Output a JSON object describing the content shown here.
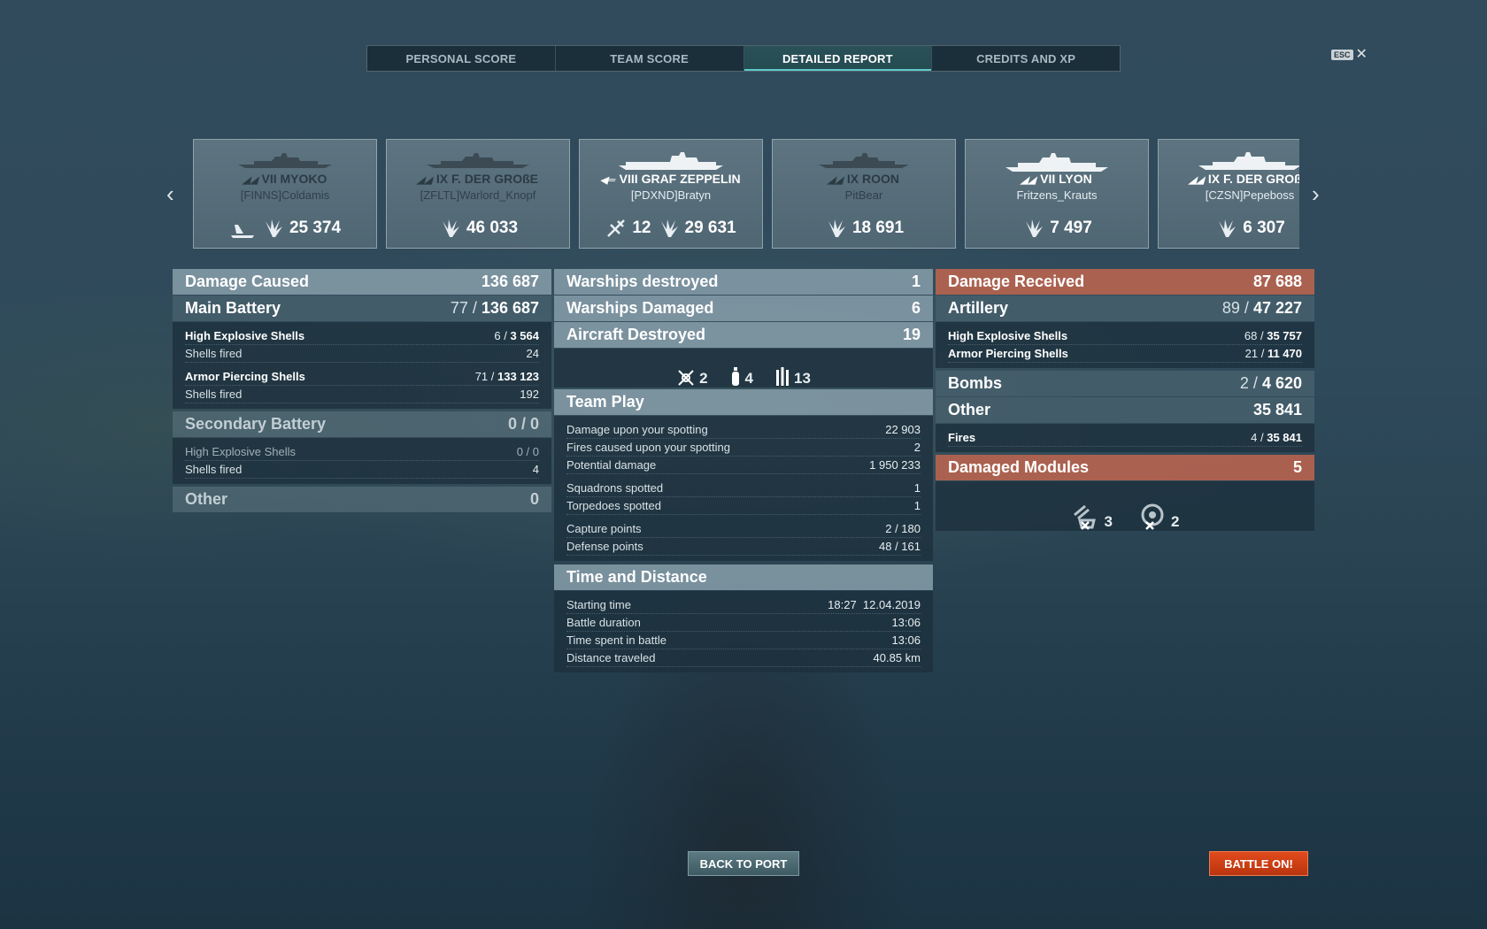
{
  "tabs": [
    {
      "label": "PERSONAL SCORE"
    },
    {
      "label": "TEAM SCORE"
    },
    {
      "label": "DETAILED REPORT"
    },
    {
      "label": "CREDITS AND XP"
    }
  ],
  "esc": {
    "badge": "ESC",
    "close": "✕"
  },
  "nav": {
    "prev": "‹",
    "next": "›"
  },
  "cards": [
    {
      "tier_name": "VII MYOKO",
      "player": "[FINNS]Coldamis",
      "stats": [
        {
          "icon": "torpedo-hit-icon",
          "value": ""
        },
        {
          "icon": "damage-icon",
          "value": "25 374"
        }
      ]
    },
    {
      "tier_name": "IX F. DER GROßE",
      "player": "[ZFLTL]Warlord_Knopf",
      "stats": [
        {
          "icon": "damage-icon",
          "value": "46 033"
        }
      ]
    },
    {
      "tier_name": "VIII GRAF ZEPPELIN",
      "player": "[PDXND]Bratyn",
      "stats": [
        {
          "icon": "aircraft-destroyed-icon",
          "value": "12"
        },
        {
          "icon": "damage-icon",
          "value": "29 631"
        }
      ]
    },
    {
      "tier_name": "IX ROON",
      "player": "PitBear",
      "stats": [
        {
          "icon": "damage-icon",
          "value": "18 691"
        }
      ]
    },
    {
      "tier_name": "VII LYON",
      "player": "Fritzens_Krauts",
      "stats": [
        {
          "icon": "damage-icon",
          "value": "7 497"
        }
      ]
    },
    {
      "tier_name": "IX F. DER GROßE",
      "player": "[CZSN]Pepeboss",
      "stats": [
        {
          "icon": "damage-icon",
          "value": "6 307"
        }
      ]
    }
  ],
  "left": {
    "damage_caused": {
      "label": "Damage Caused",
      "value": "136 687"
    },
    "main_battery": {
      "label": "Main Battery",
      "hits": "77 /",
      "damage": "136 687"
    },
    "he": {
      "label": "High Explosive Shells",
      "hits": "6 /",
      "damage": "3 564"
    },
    "he_fired": {
      "label": "Shells fired",
      "value": "24"
    },
    "ap": {
      "label": "Armor Piercing Shells",
      "hits": "71 /",
      "damage": "133 123"
    },
    "ap_fired": {
      "label": "Shells fired",
      "value": "192"
    },
    "secondary": {
      "label": "Secondary Battery",
      "value": "0 / 0"
    },
    "sec_he": {
      "label": "High Explosive Shells",
      "value": "0 / 0"
    },
    "sec_fired": {
      "label": "Shells fired",
      "value": "4"
    },
    "other": {
      "label": "Other",
      "value": "0"
    }
  },
  "middle": {
    "warships_destroyed": {
      "label": "Warships destroyed",
      "value": "1"
    },
    "warships_damaged": {
      "label": "Warships Damaged",
      "value": "6"
    },
    "aircraft_destroyed": {
      "label": "Aircraft Destroyed",
      "value": "19"
    },
    "aircraft_breakdown": [
      {
        "icon": "fighter-icon",
        "value": "2"
      },
      {
        "icon": "bomber-icon",
        "value": "4"
      },
      {
        "icon": "torpedo-bomber-icon",
        "value": "13"
      }
    ],
    "team_play": {
      "label": "Team Play"
    },
    "rows_a": [
      {
        "label": "Damage upon your spotting",
        "value": "22 903"
      },
      {
        "label": "Fires caused upon your spotting",
        "value": "2"
      },
      {
        "label": "Potential damage",
        "value": "1 950 233"
      }
    ],
    "rows_b": [
      {
        "label": "Squadrons spotted",
        "value": "1"
      },
      {
        "label": "Torpedoes spotted",
        "value": "1"
      }
    ],
    "rows_c": [
      {
        "label": "Capture points",
        "value": "2 / 180"
      },
      {
        "label": "Defense points",
        "value": "48 / 161"
      }
    ],
    "time_distance": {
      "label": "Time and Distance"
    },
    "rows_d": [
      {
        "label": "Starting time",
        "value": "18:27  12.04.2019"
      },
      {
        "label": "Battle duration",
        "value": "13:06"
      },
      {
        "label": "Time spent in battle",
        "value": "13:06"
      },
      {
        "label": "Distance traveled",
        "value": "40.85 km"
      }
    ]
  },
  "right": {
    "damage_received": {
      "label": "Damage Received",
      "value": "87 688"
    },
    "artillery": {
      "label": "Artillery",
      "hits": "89 /",
      "damage": "47 227"
    },
    "he": {
      "label": "High Explosive Shells",
      "hits": "68 /",
      "damage": "35 757"
    },
    "ap": {
      "label": "Armor Piercing Shells",
      "hits": "21 /",
      "damage": "11 470"
    },
    "bombs": {
      "label": "Bombs",
      "hits": "2 /",
      "damage": "4 620"
    },
    "other": {
      "label": "Other",
      "value": "35 841"
    },
    "fires": {
      "label": "Fires",
      "hits": "4 /",
      "damage": "35 841"
    },
    "damaged_modules": {
      "label": "Damaged Modules",
      "value": "5"
    },
    "modules": [
      {
        "icon": "gun-turret-disabled-icon",
        "value": "3"
      },
      {
        "icon": "steering-gear-disabled-icon",
        "value": "2"
      }
    ]
  },
  "buttons": {
    "back_to_port": "BACK TO PORT",
    "battle_on": "BATTLE ON!"
  }
}
